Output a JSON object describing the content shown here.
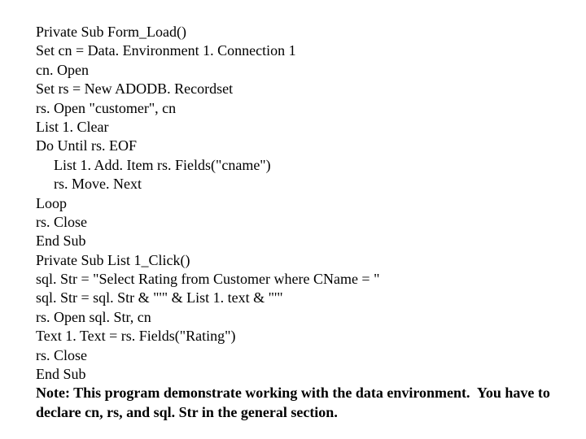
{
  "code": {
    "l01": "Private Sub Form_Load()",
    "l02": "Set cn = Data. Environment 1. Connection 1",
    "l03": "cn. Open",
    "l04": "Set rs = New ADODB. Recordset",
    "l05": "rs. Open \"customer\", cn",
    "l06": "List 1. Clear",
    "l07": "Do Until rs. EOF",
    "l08": "List 1. Add. Item rs. Fields(\"cname\")",
    "l09": "rs. Move. Next",
    "l10": "Loop",
    "l11": "rs. Close",
    "l12": "End Sub",
    "l13": "Private Sub List 1_Click()",
    "l14": "sql. Str = \"Select Rating from Customer where CName = \"",
    "l15": "sql. Str = sql. Str & \"'\" & List 1. text & \"'\"",
    "l16": "rs. Open sql. Str, cn",
    "l17": "Text 1. Text = rs. Fields(\"Rating\")",
    "l18": "rs. Close",
    "l19": "End Sub"
  },
  "note": "Note: This program demonstrate working with the data environment.  You have to declare cn, rs, and sql. Str in the general section."
}
